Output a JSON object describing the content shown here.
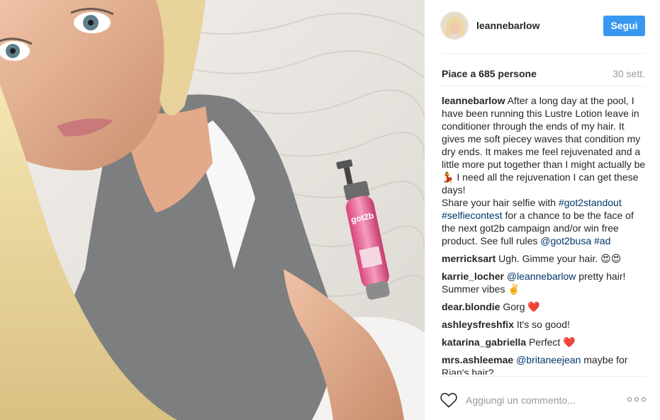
{
  "post": {
    "author": "leannebarlow",
    "follow_label": "Segui",
    "likes": "Piace a 685 persone",
    "time": "30 sett."
  },
  "caption": {
    "user": "leannebarlow",
    "text_1": "After a long day at the pool, I have been running this Lustre Lotion leave in conditioner through the ends of my hair. It gives me soft piecey waves that condition my dry ends. It makes me feel rejuvenated and a little more put together than I might actually be 💃 I need all the rejuvenation I can get these days!\nShare your hair selfie with ",
    "tag_1": "#got2standout",
    "space_1": " ",
    "tag_2": "#selfiecontest",
    "text_2": " for a chance to be the face of the next got2b campaign and/or win free product. See full rules ",
    "mention_1": "@got2busa",
    "space_2": " ",
    "tag_3": "#ad"
  },
  "comments": [
    {
      "user": "merricksart",
      "text": " Ugh. Gimme your hair. 😍😍"
    },
    {
      "user": "karrie_locher",
      "mention": "@leannebarlow",
      "text": " pretty hair! Summer vibes ✌️"
    },
    {
      "user": "dear.blondie",
      "text": " Gorg ❤️"
    },
    {
      "user": "ashleysfreshfix",
      "text": " It's so good!"
    },
    {
      "user": "katarina_gabriella",
      "text": " Perfect ❤️"
    },
    {
      "user": "mrs.ashleemae",
      "mention": "@britaneejean",
      "text": " maybe for Rian's hair?"
    }
  ],
  "footer": {
    "comment_placeholder": "Aggiungi un commento..."
  },
  "icons": {
    "like": "heart-icon",
    "more": "more-options-icon"
  },
  "colors": {
    "accent": "#3897f0",
    "link": "#003569"
  }
}
